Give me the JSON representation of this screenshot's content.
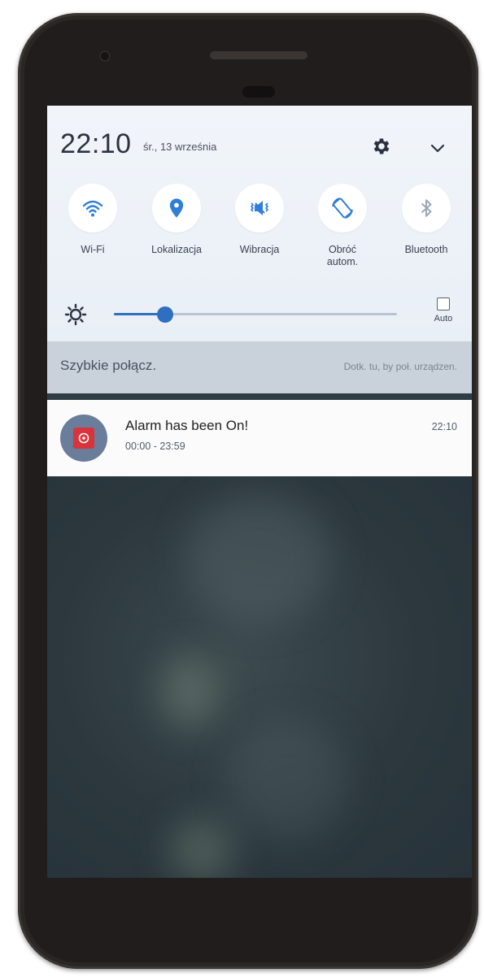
{
  "status": {
    "time": "22:10",
    "date": "śr., 13 września"
  },
  "header_icons": {
    "settings": "gear-icon",
    "expand": "chevron-down-icon"
  },
  "tiles": [
    {
      "label": "Wi-Fi",
      "icon": "wifi-icon",
      "active": true
    },
    {
      "label": "Lokalizacja",
      "icon": "location-icon",
      "active": true
    },
    {
      "label": "Wibracja",
      "icon": "vibrate-icon",
      "active": true
    },
    {
      "label": "Obróć autom.",
      "icon": "auto-rotate-icon",
      "active": true
    },
    {
      "label": "Bluetooth",
      "icon": "bluetooth-icon",
      "active": false
    }
  ],
  "brightness": {
    "level": 0.18,
    "auto_label": "Auto",
    "auto_checked": false
  },
  "quick_connect": {
    "title": "Szybkie połącz.",
    "hint": "Dotk. tu, by poł. urządzen."
  },
  "notification": {
    "title": "Alarm has been On!",
    "subtitle": "00:00 - 23:59",
    "time": "22:10"
  },
  "colors": {
    "accent": "#2f6fc0",
    "panel": "#eef2f7",
    "notification_icon_bg": "#6a7d9b",
    "notification_icon_fg": "#d8343c"
  }
}
